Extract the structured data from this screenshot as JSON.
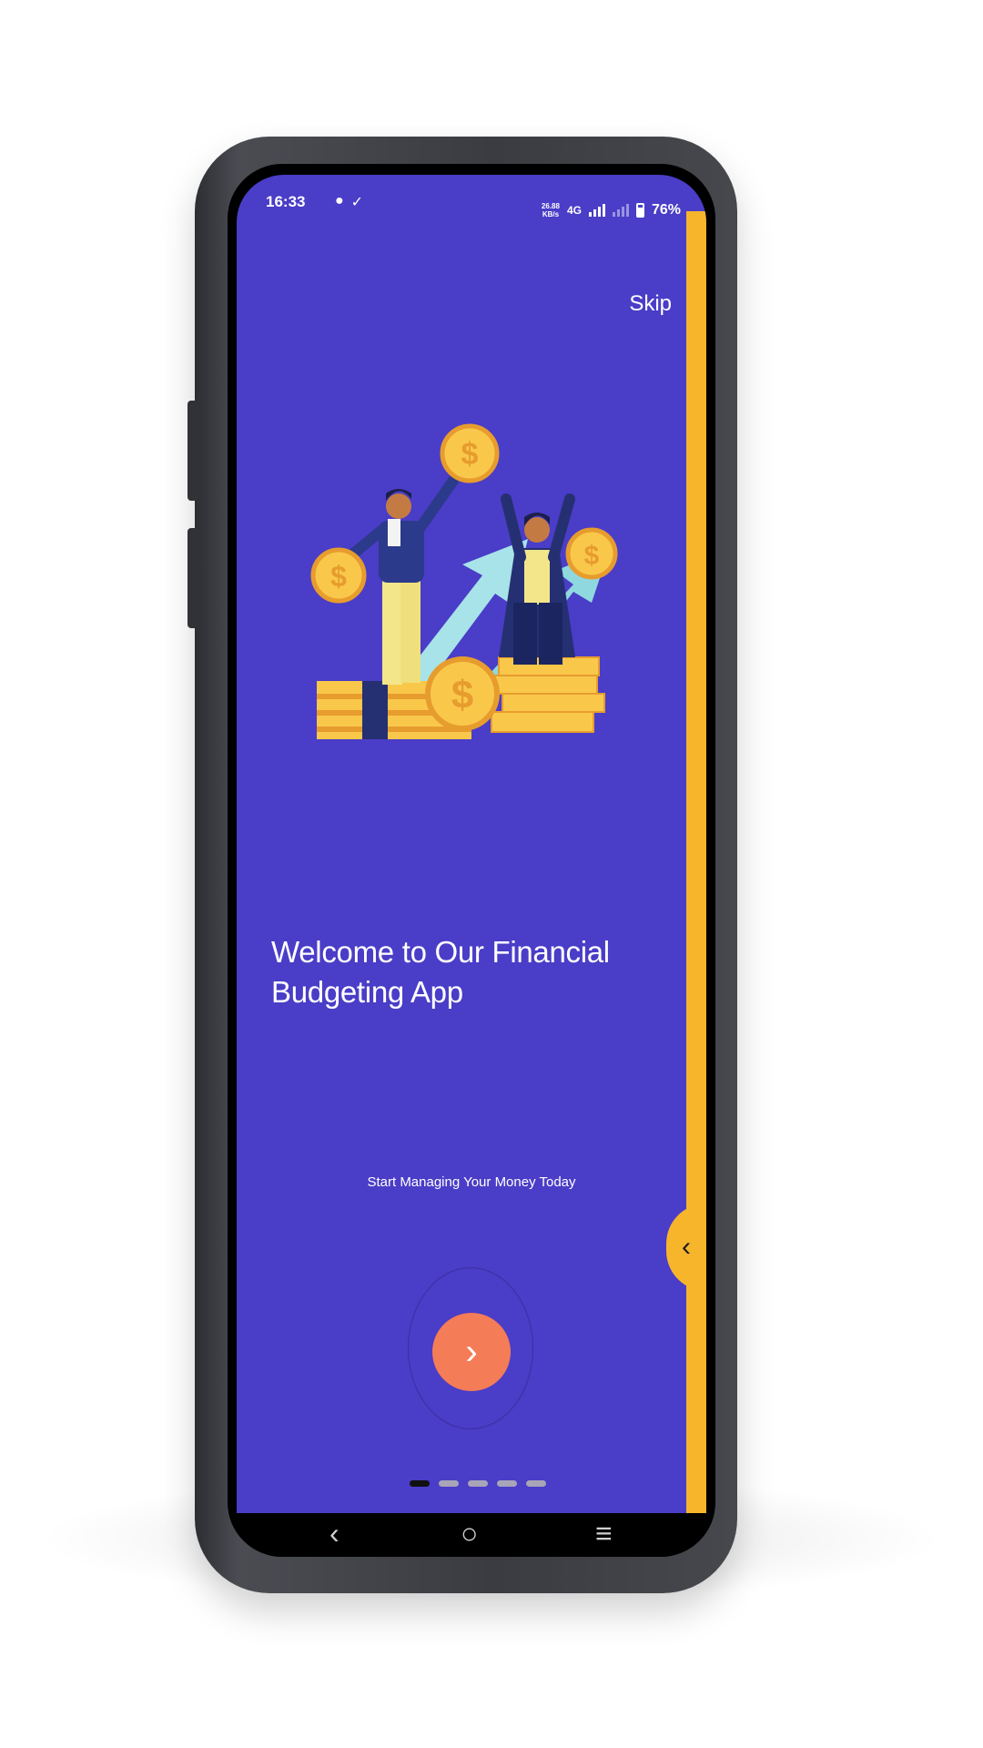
{
  "status_bar": {
    "time": "16:33",
    "notification_icons": [
      "chat-bubble-icon",
      "download-check-icon"
    ],
    "data_speed_value": "26.88",
    "data_speed_unit": "KB/s",
    "network": "4G",
    "battery": "76%",
    "battery_level": 0.76
  },
  "onboarding": {
    "skip_label": "Skip",
    "title_line1": "Welcome to Our Financial",
    "title_line2": "Budgeting App",
    "subtitle": "Start Managing Your Money Today",
    "coin_symbol": "$",
    "next_icon": "chevron-right-icon",
    "prev_tab_icon": "chevron-left-icon",
    "next_glyph": "›",
    "prev_glyph": "‹",
    "page_count": 5,
    "current_page": 1
  },
  "nav_bar": {
    "back_glyph": "‹",
    "home_glyph": "○",
    "recents_glyph": "≡"
  },
  "colors": {
    "screen_background": "#4a3dc7",
    "accent_yellow": "#f7b52c",
    "next_button": "#f47c56",
    "text": "#ffffff",
    "coin": "#f9c84a",
    "arrow": "#8fd8e0",
    "phone_frame": "#3a3c41"
  }
}
